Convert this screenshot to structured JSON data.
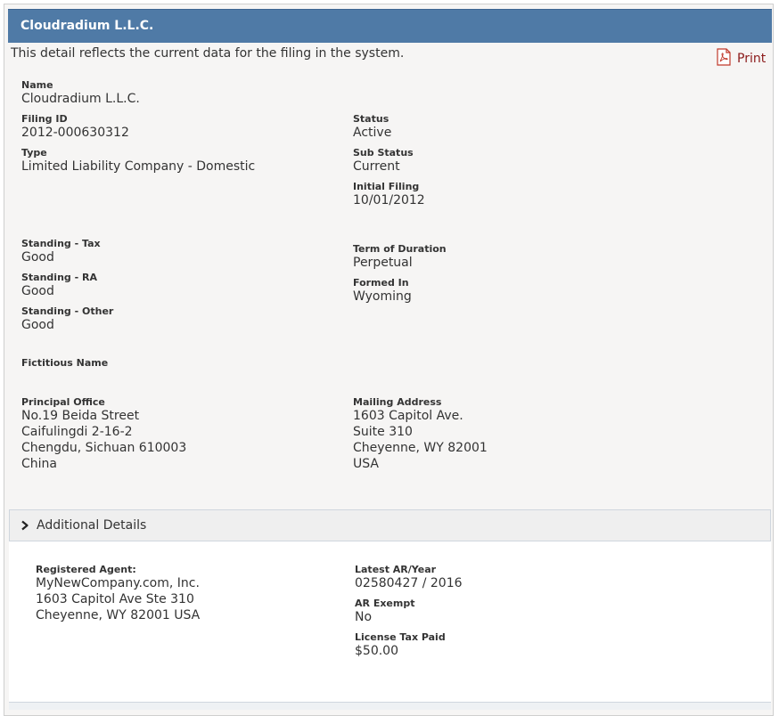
{
  "header": {
    "title": "Cloudradium L.L.C."
  },
  "intro": "This detail reflects the current data for the filing in the system.",
  "print": {
    "label": "Print",
    "icon": "pdf-icon"
  },
  "fields": {
    "name": {
      "label": "Name",
      "value": "Cloudradium L.L.C."
    },
    "filing_id": {
      "label": "Filing ID",
      "value": "2012-000630312"
    },
    "type": {
      "label": "Type",
      "value": "Limited Liability Company - Domestic"
    },
    "status": {
      "label": "Status",
      "value": "Active"
    },
    "sub_status": {
      "label": "Sub Status",
      "value": "Current"
    },
    "initial_filing": {
      "label": "Initial Filing",
      "value": "10/01/2012"
    },
    "standing_tax": {
      "label": "Standing - Tax",
      "value": "Good"
    },
    "standing_ra": {
      "label": "Standing - RA",
      "value": "Good"
    },
    "standing_other": {
      "label": "Standing - Other",
      "value": "Good"
    },
    "term_of_duration": {
      "label": "Term of Duration",
      "value": "Perpetual"
    },
    "formed_in": {
      "label": "Formed In",
      "value": "Wyoming"
    },
    "fictitious_name": {
      "label": "Fictitious Name",
      "value": ""
    },
    "principal_office": {
      "label": "Principal Office",
      "lines": [
        "No.19 Beida Street",
        "Caifulingdi 2-16-2",
        "Chengdu, Sichuan 610003",
        "China"
      ]
    },
    "mailing_address": {
      "label": "Mailing Address",
      "lines": [
        "1603 Capitol Ave.",
        "Suite 310",
        "Cheyenne, WY 82001",
        "USA"
      ]
    }
  },
  "additional": {
    "toggle_label": "Additional Details",
    "registered_agent": {
      "label": "Registered Agent:",
      "lines": [
        "MyNewCompany.com, Inc.",
        "1603 Capitol Ave Ste 310",
        "Cheyenne, WY 82001 USA"
      ]
    },
    "latest_ar_year": {
      "label": "Latest AR/Year",
      "value": "02580427 / 2016"
    },
    "ar_exempt": {
      "label": "AR Exempt",
      "value": "No"
    },
    "license_tax_paid": {
      "label": "License Tax Paid",
      "value": "$50.00"
    }
  },
  "colors": {
    "header_bg": "#4f7aa6",
    "print_text": "#8b1a1a",
    "pdf_icon": "#c0392b"
  }
}
